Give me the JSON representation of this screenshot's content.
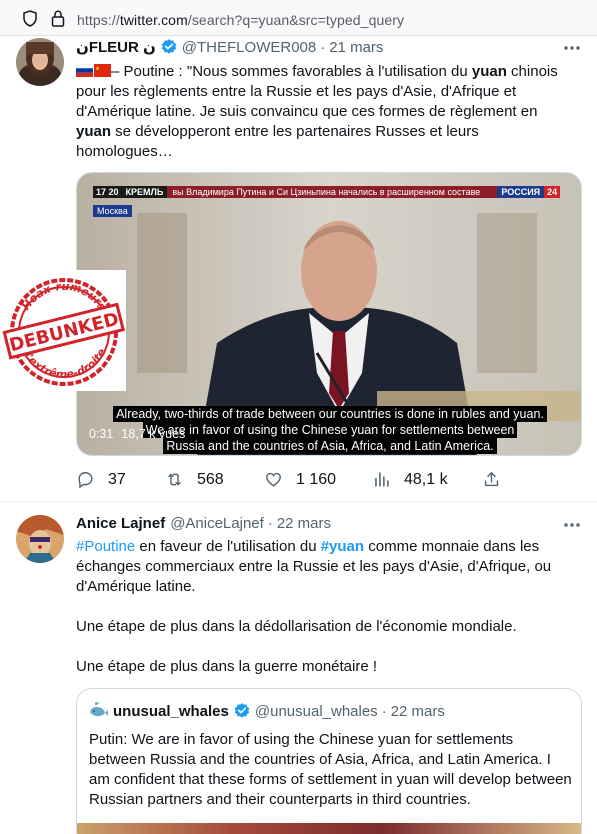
{
  "browser": {
    "url_prefix": "https://",
    "url_domain": "twitter.com",
    "url_path": "/search?q=yuan&src=typed_query"
  },
  "tweet1": {
    "name": "ﻥFLEUR ﻥ",
    "handle": "@THEFLOWER008",
    "separator": "·",
    "date": "21 mars",
    "text_segments": {
      "s1": "– Poutine : \"Nous sommes favorables à l'utilisation du ",
      "k1": "yuan",
      "s2": " chinois pour les règlements entre la Russie et les pays d'Asie, d'Afrique et d'Amérique latine. Je suis convaincu que ces formes de règlement en ",
      "k2": "yuan",
      "s3": " se développeront entre les partenaires Russes et leurs homologues…"
    },
    "video": {
      "tv_time": "17 20",
      "tv_channel_left": "КРЕМЛЬ",
      "tv_ticker": "вы Владимира Путина и Си Цзиньпина начались в расширенном составе",
      "tv_channel_right": "РОССИЯ",
      "tv_channel_num": "24",
      "tv_location": "Москва",
      "subtitle_1": "Already, two-thirds of trade between our countries is done in rubles and yuan.",
      "subtitle_2": "We are in favor of using the Chinese yuan for settlements between",
      "subtitle_3": "Russia and the countries of Asia, Africa, and Latin America.",
      "duration": "0:31",
      "views": "18,7 k vues"
    },
    "stats": {
      "replies": "37",
      "retweets": "568",
      "likes": "1 160",
      "views": "48,1 k"
    }
  },
  "stamp": {
    "top_text": "Hoax-rumeurs",
    "main_text": "DEBUNKED",
    "bottom_text": "d'extrême-droite"
  },
  "tweet2": {
    "name": "Anice Lajnef",
    "handle": "@AniceLajnef",
    "separator": "·",
    "date": "22 mars",
    "tag1": "#Poutine",
    "s1": " en faveur de l'utilisation du ",
    "tag2": "#yuan",
    "s2": " comme monnaie dans les échanges commerciaux entre la Russie et les pays d'Asie, d'Afrique, ou d'Amérique latine.",
    "para2": "Une étape de plus dans la dédollarisation de l'économie mondiale.",
    "para3": "Une étape de plus dans la guerre monétaire !",
    "quote": {
      "name": "unusual_whales",
      "handle": "@unusual_whales",
      "separator": "·",
      "date": "22 mars",
      "text": "Putin: We are in favor of using the Chinese yuan for settlements between Russia and the countries of Asia, Africa, and Latin America. I am confident that these forms of settlement in yuan will develop between Russian partners and their counterparts in third countries."
    }
  },
  "colors": {
    "accent": "#1d9bf0",
    "secondary_text": "#536471",
    "stamp_red": "#d2232a"
  }
}
